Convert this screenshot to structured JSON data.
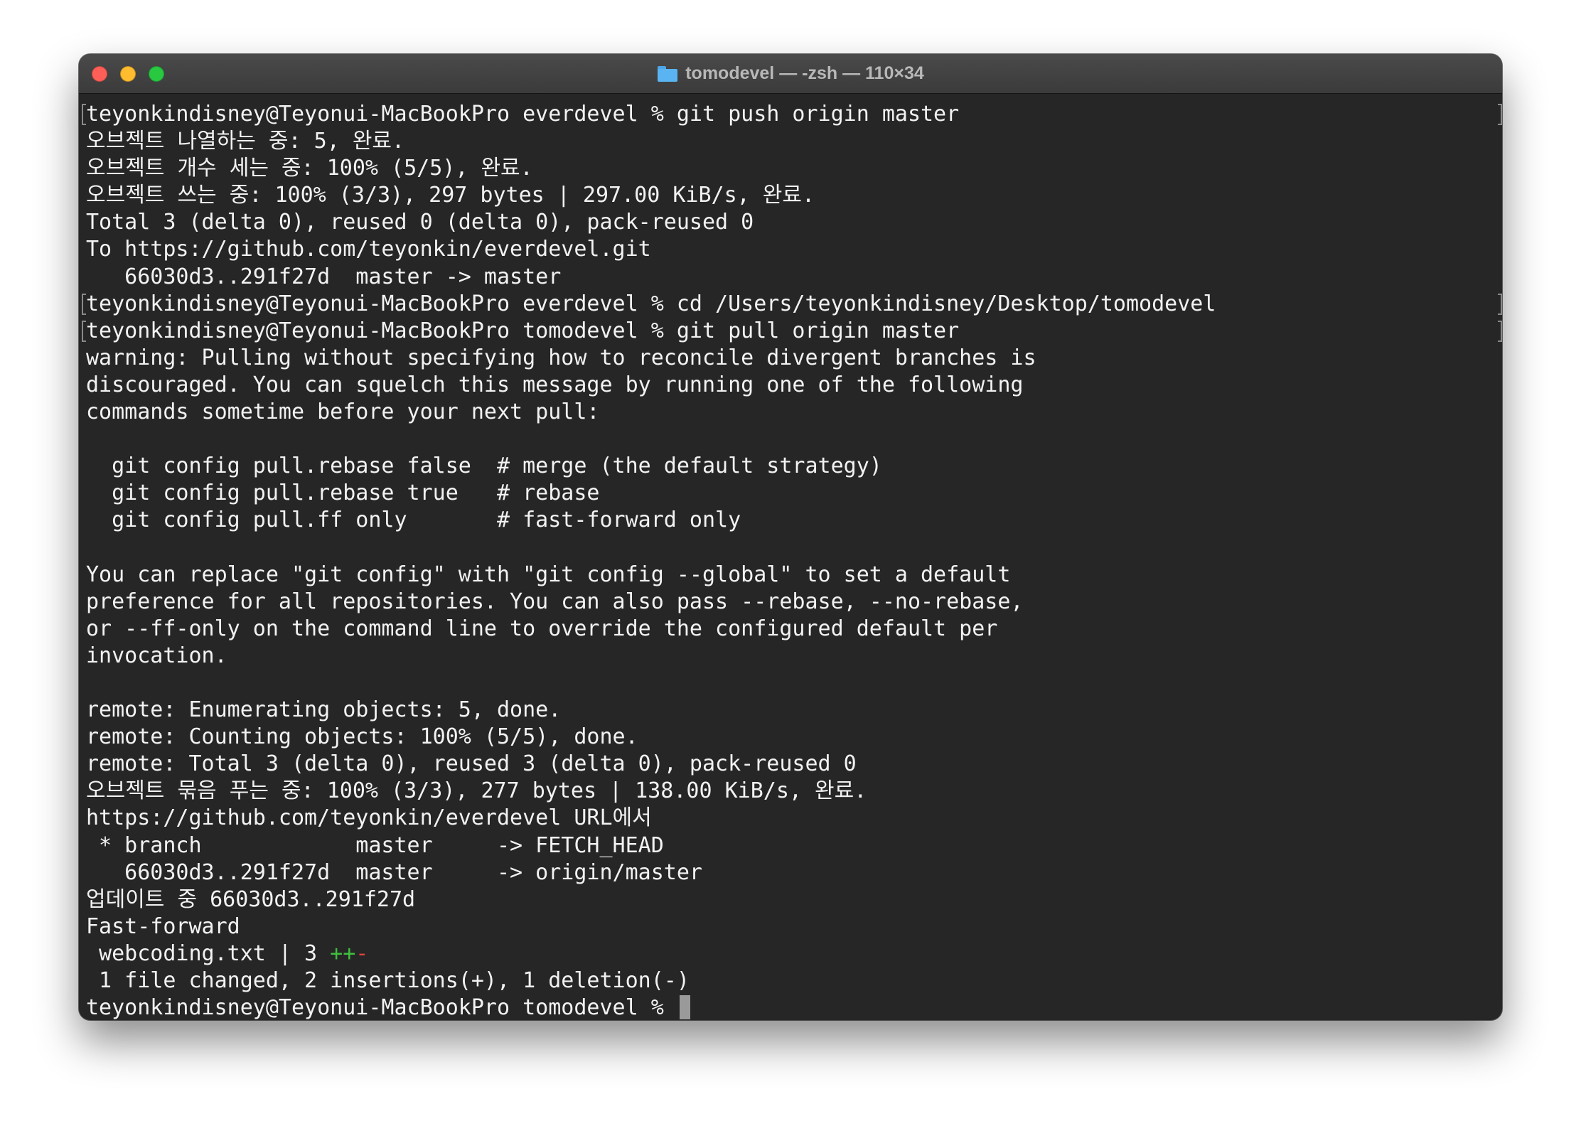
{
  "window": {
    "title": "tomodevel — -zsh — 110×34",
    "icon": "folder-icon"
  },
  "terminal": {
    "lines": [
      "teyonkindisney@Teyonui-MacBookPro everdevel % git push origin master",
      "오브젝트 나열하는 중: 5, 완료.",
      "오브젝트 개수 세는 중: 100% (5/5), 완료.",
      "오브젝트 쓰는 중: 100% (3/3), 297 bytes | 297.00 KiB/s, 완료.",
      "Total 3 (delta 0), reused 0 (delta 0), pack-reused 0",
      "To https://github.com/teyonkin/everdevel.git",
      "   66030d3..291f27d  master -> master",
      "teyonkindisney@Teyonui-MacBookPro everdevel % cd /Users/teyonkindisney/Desktop/tomodevel",
      "teyonkindisney@Teyonui-MacBookPro tomodevel % git pull origin master",
      "warning: Pulling without specifying how to reconcile divergent branches is",
      "discouraged. You can squelch this message by running one of the following",
      "commands sometime before your next pull:",
      "",
      "  git config pull.rebase false  # merge (the default strategy)",
      "  git config pull.rebase true   # rebase",
      "  git config pull.ff only       # fast-forward only",
      "",
      "You can replace \"git config\" with \"git config --global\" to set a default",
      "preference for all repositories. You can also pass --rebase, --no-rebase,",
      "or --ff-only on the command line to override the configured default per",
      "invocation.",
      "",
      "remote: Enumerating objects: 5, done.",
      "remote: Counting objects: 100% (5/5), done.",
      "remote: Total 3 (delta 0), reused 3 (delta 0), pack-reused 0",
      "오브젝트 묶음 푸는 중: 100% (3/3), 277 bytes | 138.00 KiB/s, 완료.",
      "https://github.com/teyonkin/everdevel URL에서",
      " * branch            master     -> FETCH_HEAD",
      "   66030d3..291f27d  master     -> origin/master",
      "업데이트 중 66030d3..291f27d",
      "Fast-forward"
    ],
    "stat_line": {
      "file": " webcoding.txt | 3 ",
      "plus": "++",
      "minus": "-"
    },
    "summary_line": " 1 file changed, 2 insertions(+), 1 deletion(-)",
    "prompt": "teyonkindisney@Teyonui-MacBookPro tomodevel % "
  }
}
